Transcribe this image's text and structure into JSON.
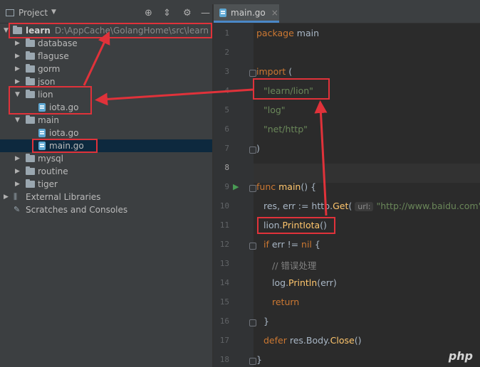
{
  "project_panel": {
    "title": "Project",
    "root": {
      "name": "learn",
      "path": "D:\\AppCache\\GolangHome\\src\\learn"
    },
    "items": [
      {
        "label": "database"
      },
      {
        "label": "flaguse"
      },
      {
        "label": "gorm"
      },
      {
        "label": "json"
      },
      {
        "label": "lion"
      },
      {
        "label": "iota.go"
      },
      {
        "label": "main"
      },
      {
        "label": "iota.go"
      },
      {
        "label": "main.go"
      },
      {
        "label": "mysql"
      },
      {
        "label": "routine"
      },
      {
        "label": "tiger"
      },
      {
        "label": "External Libraries"
      },
      {
        "label": "Scratches and Consoles"
      }
    ]
  },
  "editor": {
    "tab": {
      "label": "main.go",
      "close": "×"
    },
    "line_numbers": [
      "1",
      "2",
      "3",
      "4",
      "5",
      "6",
      "7",
      "8",
      "9",
      "10",
      "11",
      "12",
      "13",
      "14",
      "15",
      "16",
      "17",
      "18"
    ],
    "code": {
      "l1_kw": "package",
      "l1_name": "main",
      "l3_kw": "import",
      "l3_paren": "(",
      "l4": "\"learn/lion\"",
      "l5": "\"log\"",
      "l6": "\"net/http\"",
      "l7": ")",
      "l9_kw": "func",
      "l9_fn": "main",
      "l9_rest": "() {",
      "l10_a": "res, err := ",
      "l10_pkg": "http",
      "l10_dot": ".",
      "l10_fn": "Get",
      "l10_paren": "(",
      "l10_hint": "url:",
      "l10_str": "\"http://www.baidu.com\"",
      "l10_close": ")",
      "l11_pkg": "lion",
      "l11_dot": ".",
      "l11_fn": "PrintIota",
      "l11_rest": "()",
      "l12_kw": "if",
      "l12_a": " err != ",
      "l12_nil": "nil",
      "l12_b": " {",
      "l13": "// 错误处理",
      "l14_pkg": "log",
      "l14_dot": ".",
      "l14_fn": "Println",
      "l14_rest": "(err)",
      "l15_kw": "return",
      "l16": "}",
      "l17_kw": "defer",
      "l17_a": " res.",
      "l17_b": "Body",
      "l17_c": ".",
      "l17_fn": "Close",
      "l17_d": "()",
      "l18": "}"
    }
  },
  "watermark": "php"
}
